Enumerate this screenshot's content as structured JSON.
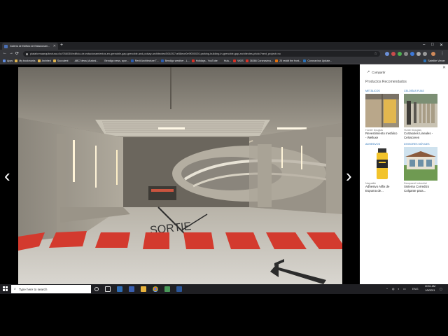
{
  "browser": {
    "tab_title": "Galería de Edificio de Estacionam...",
    "new_tab_symbol": "+",
    "window_controls": [
      "–",
      "□",
      "✕"
    ],
    "nav": [
      "←",
      "→",
      "⟳"
    ],
    "url": "plataformaarquitectura.cl/cl/766030/edificio-de-estacionamientos-en-grenoble-gap-grenoble-and-poisay-architectes/5062f17ce58ece0e9f000020-parking-building-in-grenoble-gap-architectes-photo?next_project=no"
  },
  "bookmarks": {
    "items": [
      {
        "label": "Apps",
        "color": "#5f8ce0"
      },
      {
        "label": "My bookmarks",
        "color": "#e0b44c"
      },
      {
        "label": "Archited",
        "color": "#e0b44c"
      },
      {
        "label": "Succulent",
        "color": "#e0b44c"
      },
      {
        "label": "ABC News (Austral...",
        "color": "#333333"
      },
      {
        "label": "Bendigo news, spor...",
        "color": "#333333"
      },
      {
        "label": "Revit Architecture T...",
        "color": "#2a5db0"
      },
      {
        "label": "Bendigo weather - L...",
        "color": "#2a5db0"
      },
      {
        "label": "Holidays - YouTube",
        "color": "#d93025"
      },
      {
        "label": "Hulu...",
        "color": "#333333"
      },
      {
        "label": "WOS",
        "color": "#d93025"
      },
      {
        "label": "36366 Coronavirus...",
        "color": "#d93025"
      },
      {
        "label": "25 reddit the front...",
        "color": "#e8710a"
      },
      {
        "label": "Coronavirus Update...",
        "color": "#2a72b8"
      }
    ],
    "right_label": "Satellite Viewer"
  },
  "gallery": {
    "prev_arrow": "‹",
    "next_arrow": "›",
    "floor_text": "SORTIE"
  },
  "sidepanel": {
    "close": "✕",
    "share_label": "Compartir",
    "share_icon": "↗",
    "title": "Productos Recomendados",
    "products": [
      {
        "category": "METÁLICOS",
        "brand": "Hunter Douglas",
        "name": "Revestimiento metálico - Welluxe"
      },
      {
        "category": "CELOSÍAS FIJAS",
        "brand": "Hunter Douglas",
        "name": "Cortasoles Lineales - Celoscreen"
      },
      {
        "category": "ADHESIVOS",
        "brand": "Nagualite",
        "name": "Adhesivo Ailfix de Espuma de..."
      },
      {
        "category": "DIVISORES MÓVILES",
        "brand": "Decopanel industrial",
        "name": "Sistema Corredizo Colgante para..."
      }
    ]
  },
  "taskbar": {
    "search_placeholder": "Type here to search",
    "search_icon": "⌕",
    "tray_lang": "ENG",
    "time": "10:51 AM",
    "date": "1/5/2021"
  }
}
